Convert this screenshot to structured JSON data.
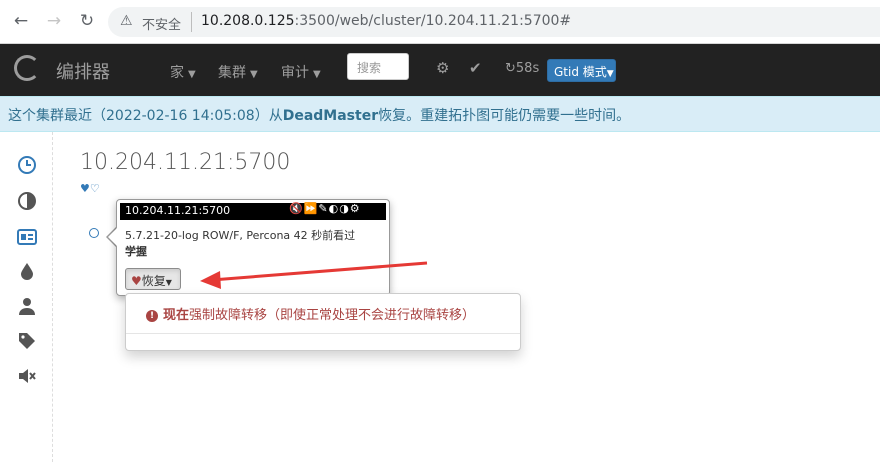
{
  "browser": {
    "back_icon": "arrow-left-icon",
    "forward_icon": "arrow-right-icon",
    "reload_icon": "reload-icon",
    "security_label": "不安全",
    "url_host": "10.208.0.125",
    "url_rest": ":3500/web/cluster/10.204.11.21:5700#"
  },
  "navbar": {
    "brand": "编排器",
    "menus": [
      "家",
      "集群",
      "审计"
    ],
    "search_placeholder": "搜索",
    "timer": "58s",
    "gtid_button": "Gtid 模式"
  },
  "alert": {
    "prefix": "这个集群最近（2022-02-16 14:05:08）从",
    "highlight": "DeadMaster",
    "suffix": "恢复。重建拓扑图可能仍需要一些时间。"
  },
  "sidebar": {
    "icons": [
      "clock-icon",
      "contrast-icon",
      "id-card-icon",
      "tint-icon",
      "user-icon",
      "tag-icon",
      "mute-icon"
    ]
  },
  "main": {
    "cluster_title": "10.204.11.21:5700",
    "hearts": "♥♡"
  },
  "popover": {
    "title": "10.204.11.21:5700",
    "tools": "🔇⏩✎◐◑⚙",
    "version_line": "5.7.21-20-log ROW/F,  Percona  42 秒前看过",
    "bold_line": "学握",
    "recover_label": "恢复"
  },
  "dropdown": {
    "bold_prefix": "现在",
    "text": "强制故障转移（即使正常处理不会进行故障转移）"
  },
  "colors": {
    "navbar_bg": "#222222",
    "alert_bg": "#d9edf7",
    "alert_text": "#31708f",
    "primary": "#337ab7",
    "danger": "#a94442",
    "annotation_arrow": "#e53935"
  }
}
